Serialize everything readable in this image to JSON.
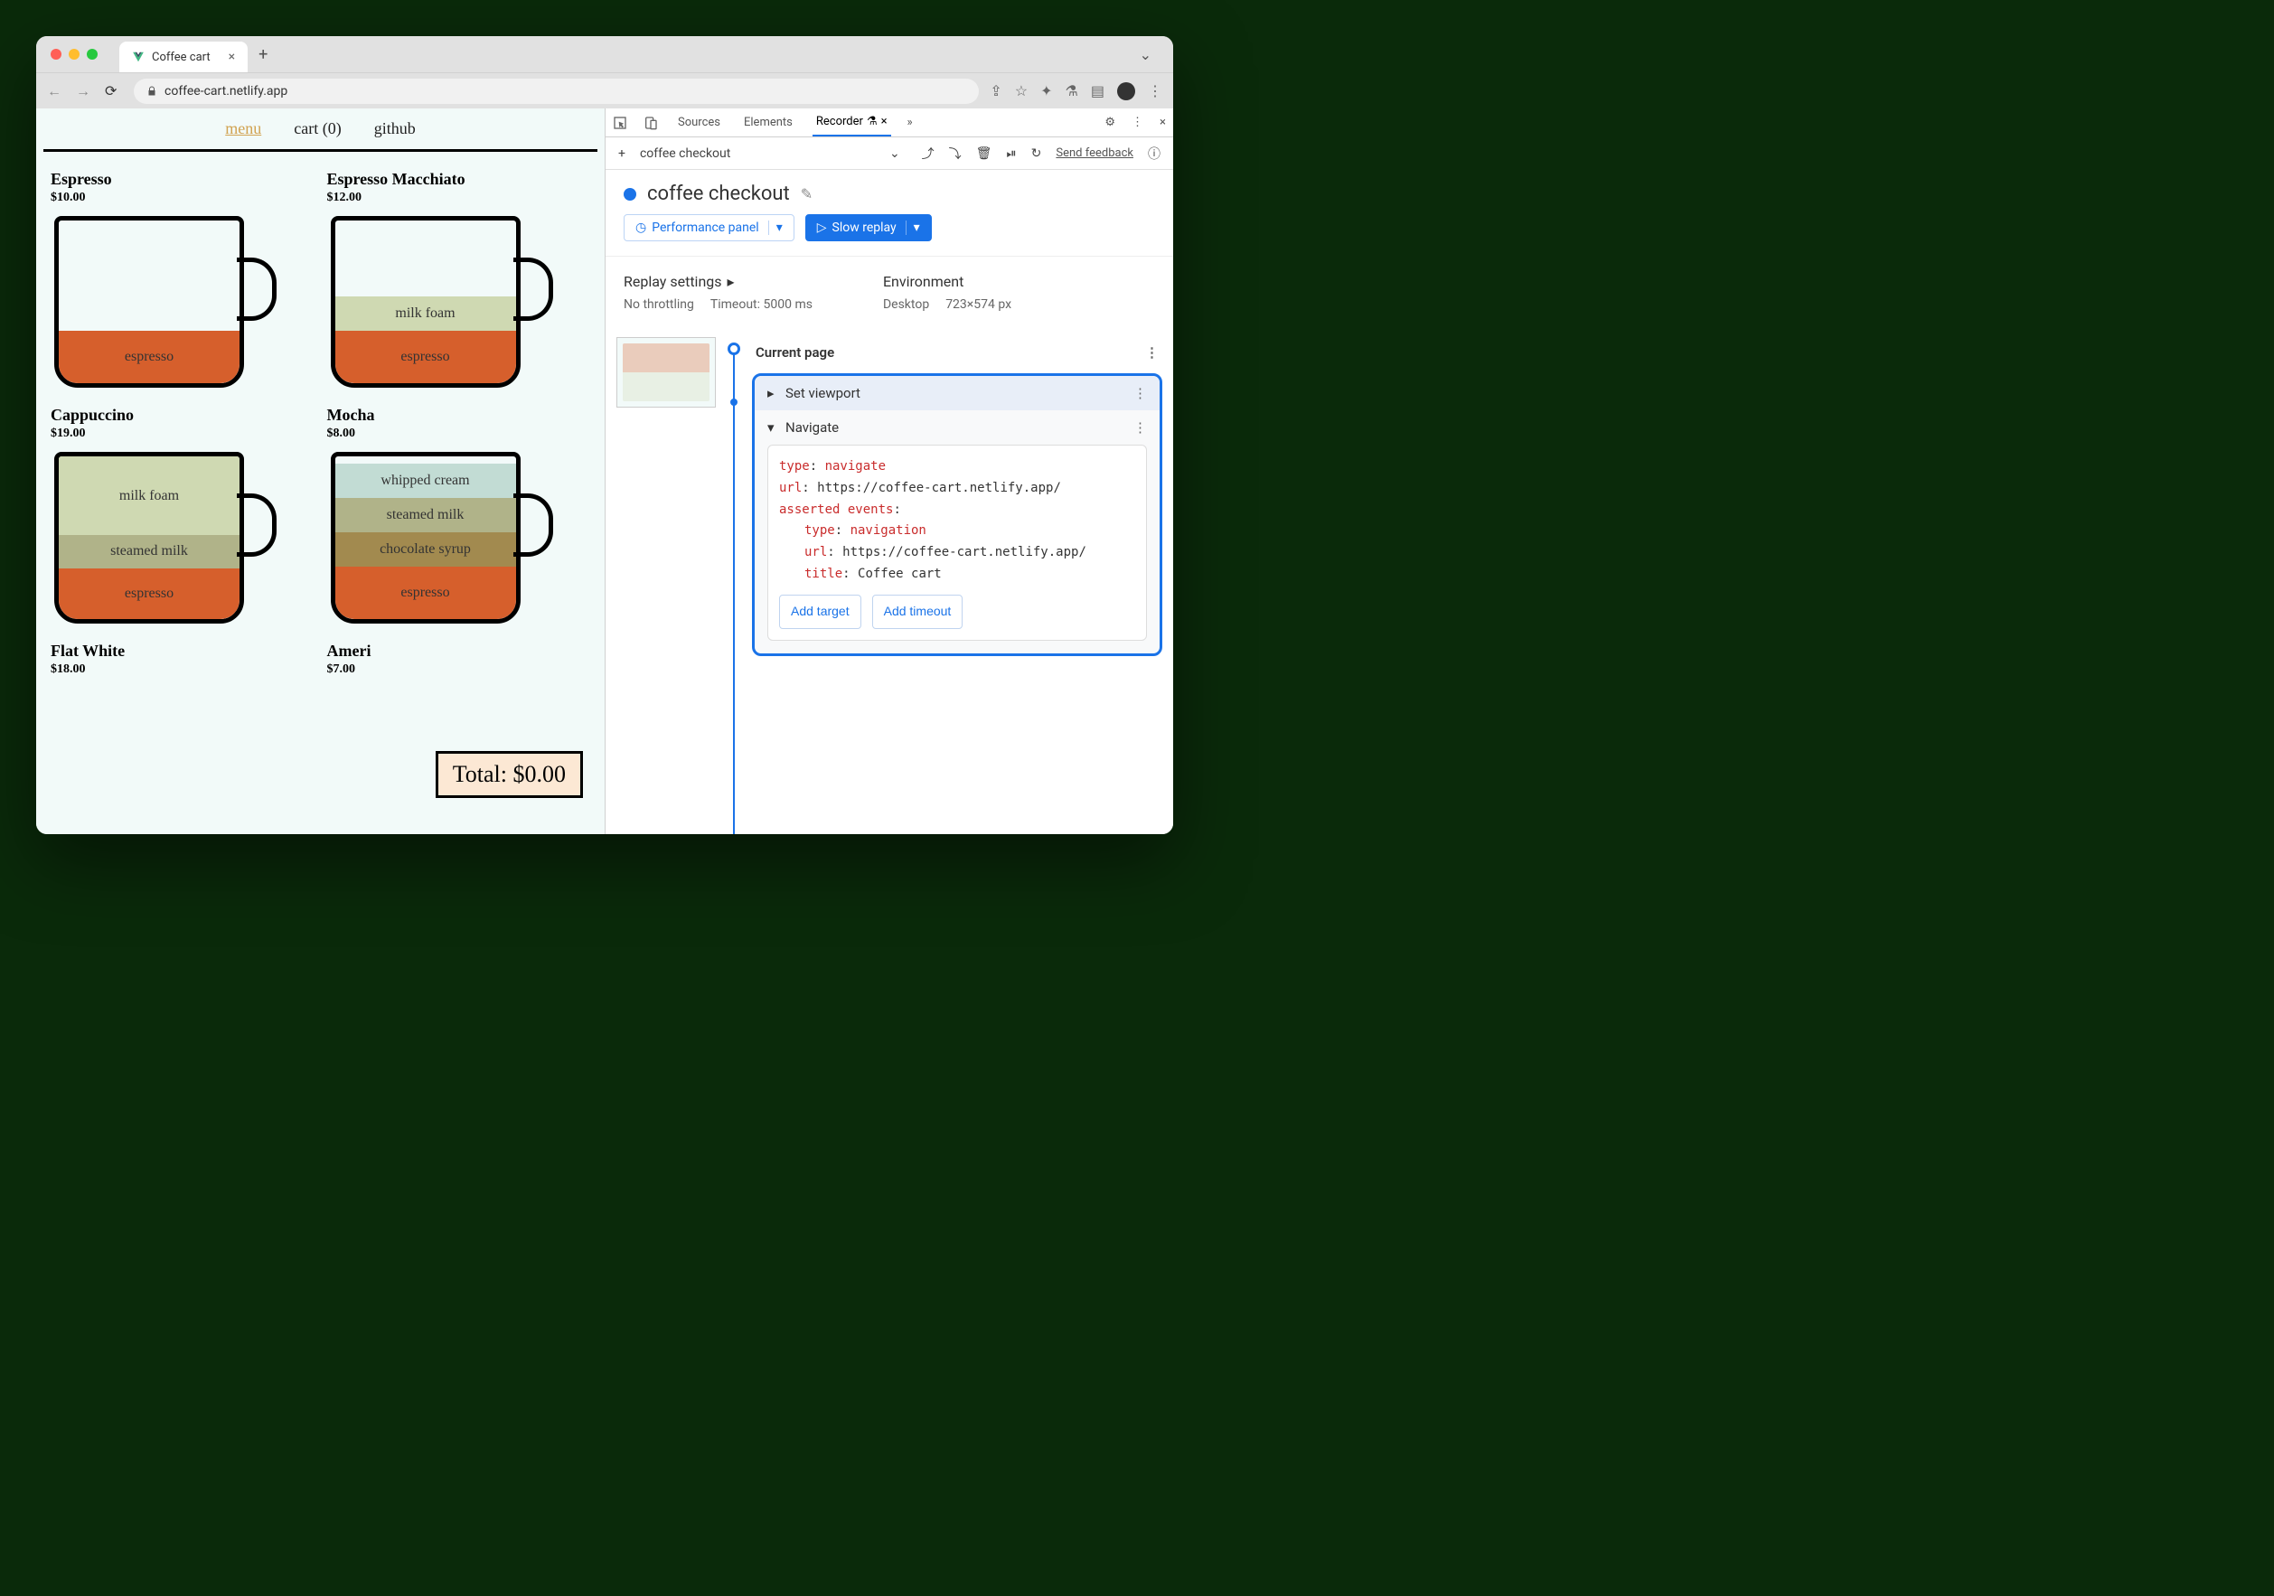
{
  "browser": {
    "tab_title": "Coffee cart",
    "url": "coffee-cart.netlify.app"
  },
  "page": {
    "nav": {
      "menu": "menu",
      "cart": "cart (0)",
      "github": "github"
    },
    "products": [
      {
        "name": "Espresso",
        "price": "$10.00",
        "layers": [
          {
            "label": "espresso",
            "cls": "espresso"
          }
        ]
      },
      {
        "name": "Espresso Macchiato",
        "price": "$12.00",
        "layers": [
          {
            "label": "espresso",
            "cls": "espresso"
          },
          {
            "label": "milk foam",
            "cls": "milkfoam"
          }
        ]
      },
      {
        "name": "Cappuccino",
        "price": "$19.00",
        "layers": [
          {
            "label": "espresso",
            "cls": "espresso"
          },
          {
            "label": "steamed milk",
            "cls": "steamed"
          },
          {
            "label": "milk foam",
            "cls": "milkfoam",
            "h": 90
          }
        ]
      },
      {
        "name": "Mocha",
        "price": "$8.00",
        "layers": [
          {
            "label": "espresso",
            "cls": "espresso"
          },
          {
            "label": "chocolate syrup",
            "cls": "choco"
          },
          {
            "label": "steamed milk",
            "cls": "steamed"
          },
          {
            "label": "whipped cream",
            "cls": "whipped"
          }
        ]
      },
      {
        "name": "Flat White",
        "price": "$18.00"
      },
      {
        "name": "Ameri",
        "price": "$7.00"
      }
    ],
    "total": "Total: $0.00"
  },
  "devtools": {
    "tabs": {
      "sources": "Sources",
      "elements": "Elements",
      "recorder": "Recorder"
    },
    "toolbar": {
      "recording_name": "coffee checkout",
      "feedback": "Send feedback"
    },
    "recorder": {
      "title": "coffee checkout",
      "perf_btn": "Performance panel",
      "replay_btn": "Slow replay",
      "replay_settings": {
        "label": "Replay settings",
        "throttling": "No throttling",
        "timeout": "Timeout: 5000 ms"
      },
      "environment": {
        "label": "Environment",
        "device": "Desktop",
        "viewport": "723×574 px"
      },
      "current_page": "Current page",
      "steps": {
        "set_viewport": "Set viewport",
        "navigate": "Navigate"
      },
      "details": {
        "type_k": "type",
        "type_v": "navigate",
        "url_k": "url",
        "url_v": "https://coffee-cart.netlify.app/",
        "asserted_k": "asserted events",
        "a_type_k": "type",
        "a_type_v": "navigation",
        "a_url_k": "url",
        "a_url_v": "https://coffee-cart.netlify.app/",
        "a_title_k": "title",
        "a_title_v": "Coffee cart",
        "add_target": "Add target",
        "add_timeout": "Add timeout"
      }
    }
  }
}
